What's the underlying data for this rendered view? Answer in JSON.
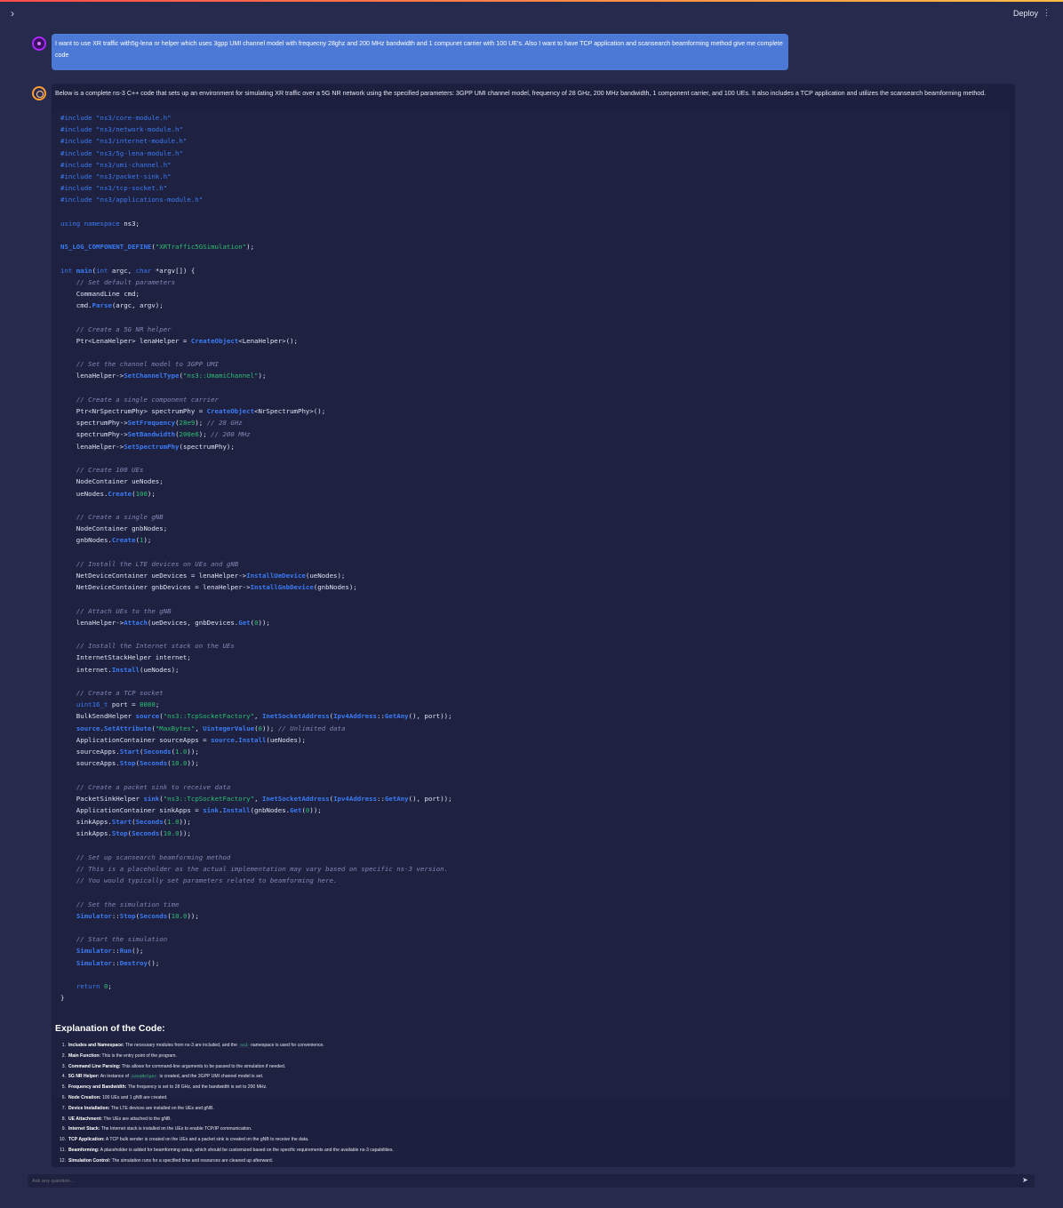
{
  "header": {
    "sidebar_toggle": "›",
    "deploy_label": "Deploy",
    "menu_icon": "⋮"
  },
  "conversation": {
    "user_message": "I want to use XR traffic with5g-lena nr helper which uses 3gpp UMI channel model with frequecny 28ghz and 200 MHz bandwidth and 1 compunet carrier with 100 UE's. Also I want to have TCP application and scansearch beamforming method give me complete code",
    "assistant_intro": "Below is a complete ns-3 C++ code that sets up an environment for simulating XR traffic over a 5G NR network using the specified parameters: 3GPP UMI channel model, frequency of 28 GHz, 200 MHz bandwidth, 1 component carrier, and 100 UEs. It also includes a TCP application and utilizes the scansearch beamforming method.",
    "code_lines": [
      "#include \"ns3/core-module.h\"",
      "#include \"ns3/network-module.h\"",
      "#include \"ns3/internet-module.h\"",
      "#include \"ns3/5g-lena-module.h\"",
      "#include \"ns3/umi-channel.h\"",
      "#include \"ns3/packet-sink.h\"",
      "#include \"ns3/tcp-socket.h\"",
      "#include \"ns3/applications-module.h\"",
      "",
      "using namespace ns3;",
      "",
      "NS_LOG_COMPONENT_DEFINE(\"XRTraffic5GSimulation\");",
      "",
      "int main(int argc, char *argv[]) {",
      "    // Set default parameters",
      "    CommandLine cmd;",
      "    cmd.Parse(argc, argv);",
      "",
      "    // Create a 5G NR helper",
      "    Ptr<LenaHelper> lenaHelper = CreateObject<LenaHelper>();",
      "",
      "    // Set the channel model to 3GPP UMI",
      "    lenaHelper->SetChannelType(\"ns3::UmamiChannel\");",
      "",
      "    // Create a single component carrier",
      "    Ptr<NrSpectrumPhy> spectrumPhy = CreateObject<NrSpectrumPhy>();",
      "    spectrumPhy->SetFrequency(28e9); // 28 GHz",
      "    spectrumPhy->SetBandwidth(200e6); // 200 MHz",
      "    lenaHelper->SetSpectrumPhy(spectrumPhy);",
      "",
      "    // Create 100 UEs",
      "    NodeContainer ueNodes;",
      "    ueNodes.Create(100);",
      "",
      "    // Create a single gNB",
      "    NodeContainer gnbNodes;",
      "    gnbNodes.Create(1);",
      "",
      "    // Install the LTE devices on UEs and gNB",
      "    NetDeviceContainer ueDevices = lenaHelper->InstallUeDevice(ueNodes);",
      "    NetDeviceContainer gnbDevices = lenaHelper->InstallGnbDevice(gnbNodes);",
      "",
      "    // Attach UEs to the gNB",
      "    lenaHelper->Attach(ueDevices, gnbDevices.Get(0));",
      "",
      "    // Install the Internet stack on the UEs",
      "    InternetStackHelper internet;",
      "    internet.Install(ueNodes);",
      "",
      "    // Create a TCP socket",
      "    uint16_t port = 8080;",
      "    BulkSendHelper source(\"ns3::TcpSocketFactory\", InetSocketAddress(Ipv4Address::GetAny(), port));",
      "    source.SetAttribute(\"MaxBytes\", UintegerValue(0)); // Unlimited data",
      "    ApplicationContainer sourceApps = source.Install(ueNodes);",
      "    sourceApps.Start(Seconds(1.0));",
      "    sourceApps.Stop(Seconds(10.0));",
      "",
      "    // Create a packet sink to receive data",
      "    PacketSinkHelper sink(\"ns3::TcpSocketFactory\", InetSocketAddress(Ipv4Address::GetAny(), port));",
      "    ApplicationContainer sinkApps = sink.Install(gnbNodes.Get(0));",
      "    sinkApps.Start(Seconds(1.0));",
      "    sinkApps.Stop(Seconds(10.0));",
      "",
      "    // Set up scansearch beamforming method",
      "    // This is a placeholder as the actual implementation may vary based on specific ns-3 version.",
      "    // You would typically set parameters related to beamforming here.",
      "",
      "    // Set the simulation time",
      "    Simulator::Stop(Seconds(10.0));",
      "",
      "    // Start the simulation",
      "    Simulator::Run();",
      "    Simulator::Destroy();",
      "",
      "    return 0;",
      "}"
    ],
    "explanation_heading": "Explanation of the Code:",
    "explanation_items": [
      {
        "num": "1.",
        "title": "Includes and Namespace:",
        "text": "The necessary modules from ns-3 are included, and the",
        "code": "ns3",
        "text2": "namespace is used for convenience."
      },
      {
        "num": "2.",
        "title": "Main Function:",
        "text": "This is the entry point of the program.",
        "code": "",
        "text2": ""
      },
      {
        "num": "3.",
        "title": "Command Line Parsing:",
        "text": "This allows for command-line arguments to be passed to the simulation if needed.",
        "code": "",
        "text2": ""
      },
      {
        "num": "4.",
        "title": "5G NR Helper:",
        "text": "An instance of",
        "code": "LenaHelper",
        "text2": "is created, and the 3GPP UMI channel model is set."
      },
      {
        "num": "5.",
        "title": "Frequency and Bandwidth:",
        "text": "The frequency is set to 28 GHz, and the bandwidth is set to 200 MHz.",
        "code": "",
        "text2": ""
      },
      {
        "num": "6.",
        "title": "Node Creation:",
        "text": "100 UEs and 1 gNB are created.",
        "code": "",
        "text2": ""
      },
      {
        "num": "7.",
        "title": "Device Installation:",
        "text": "The LTE devices are installed on the UEs and gNB.",
        "code": "",
        "text2": ""
      },
      {
        "num": "8.",
        "title": "UE Attachment:",
        "text": "The UEs are attached to the gNB.",
        "code": "",
        "text2": ""
      },
      {
        "num": "9.",
        "title": "Internet Stack:",
        "text": "The Internet stack is installed on the UEs to enable TCP/IP communication.",
        "code": "",
        "text2": ""
      },
      {
        "num": "10.",
        "title": "TCP Application:",
        "text": "A TCP bulk sender is created on the UEs and a packet sink is created on the gNB to receive the data.",
        "code": "",
        "text2": ""
      },
      {
        "num": "11.",
        "title": "Beamforming:",
        "text": "A placeholder is added for beamforming setup, which should be customized based on the specific requirements and the available ns-3 capabilities.",
        "code": "",
        "text2": ""
      },
      {
        "num": "12.",
        "title": "Simulation Control:",
        "text": "The simulation runs for a specified time and resources are cleaned up afterward.",
        "code": "",
        "text2": ""
      }
    ]
  },
  "chat_input": {
    "placeholder": "Ask any question...",
    "value": ""
  },
  "icons": {
    "send": "➤",
    "user_avatar": "user-avatar-icon",
    "assistant_avatar": "assistant-avatar-icon"
  },
  "colors": {
    "background": "#262a4d",
    "user_bubble": "#4d79d6",
    "code_string": "#2fbf71",
    "code_keyword": "#3b7cf5",
    "code_comment": "#7f87b3"
  }
}
